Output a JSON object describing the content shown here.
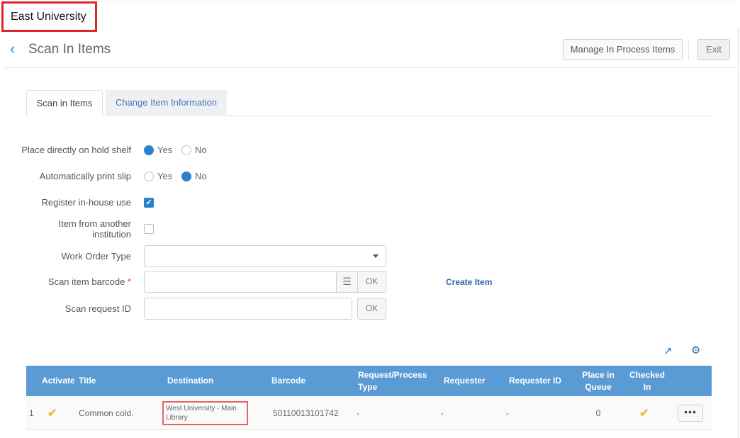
{
  "institution": "East University",
  "header": {
    "title": "Scan In Items",
    "manage_button": "Manage In Process Items",
    "exit_button": "Exit"
  },
  "tabs": [
    {
      "label": "Scan in Items",
      "active": true
    },
    {
      "label": "Change Item Information",
      "active": false
    }
  ],
  "form": {
    "hold_shelf": {
      "label": "Place directly on hold shelf",
      "yes": "Yes",
      "no": "No",
      "selected": "Yes"
    },
    "print_slip": {
      "label": "Automatically print slip",
      "yes": "Yes",
      "no": "No",
      "selected": "No"
    },
    "in_house": {
      "label": "Register in-house use",
      "checked": true
    },
    "other_inst": {
      "label_line1": "Item from another",
      "label_line2": "institution",
      "checked": false
    },
    "work_order": {
      "label": "Work Order Type",
      "value": ""
    },
    "barcode": {
      "label": "Scan item barcode",
      "required_mark": "*",
      "value": "",
      "ok": "OK"
    },
    "create_item": "Create Item",
    "request_id": {
      "label": "Scan request ID",
      "value": "",
      "ok": "OK"
    }
  },
  "table": {
    "headers": {
      "activate": "Activate",
      "title": "Title",
      "destination": "Destination",
      "barcode": "Barcode",
      "request_type_1": "Request/Process",
      "request_type_2": "Type",
      "requester": "Requester",
      "requester_id": "Requester ID",
      "place_1": "Place in",
      "place_2": "Queue",
      "checked_1": "Checked",
      "checked_2": "In"
    },
    "rows": [
      {
        "num": "1",
        "title": "Common cold.",
        "destination_1": "West University - Main",
        "destination_2": "Library",
        "barcode": "50110013101742",
        "request_type": "-",
        "requester": "-",
        "requester_id": "-",
        "place": "0",
        "actions": "•••"
      }
    ]
  },
  "colors": {
    "accent": "#2c82c9",
    "header_bg": "#5b9bd5",
    "highlight_red": "#d9262b"
  }
}
